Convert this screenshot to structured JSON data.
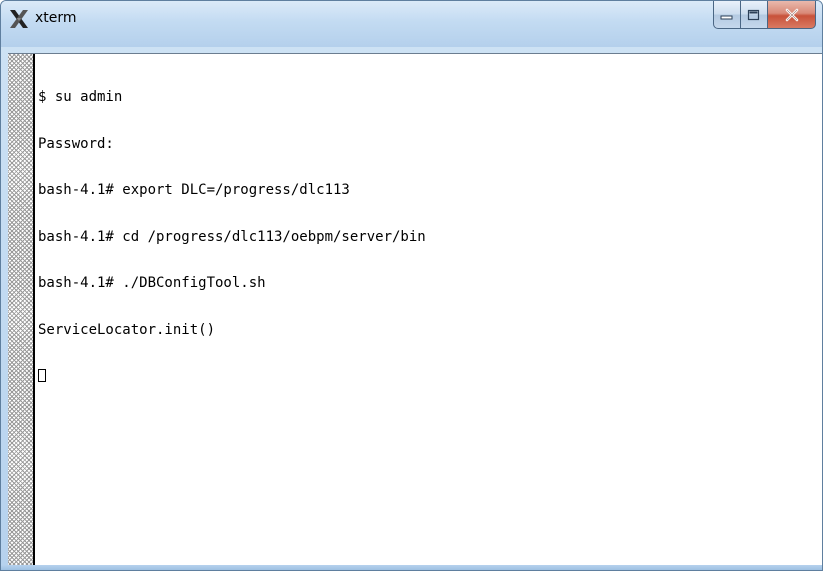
{
  "window": {
    "title": "xterm",
    "icon": "x-window-icon"
  },
  "controls": {
    "minimize_icon": "minimize-icon",
    "maximize_icon": "maximize-icon",
    "close_icon": "close-icon"
  },
  "terminal": {
    "lines": [
      "$ su admin",
      "Password:",
      "bash-4.1# export DLC=/progress/dlc113",
      "bash-4.1# cd /progress/dlc113/oebpm/server/bin",
      "bash-4.1# ./DBConfigTool.sh",
      "ServiceLocator.init()"
    ],
    "cursor": "block-cursor"
  },
  "colors": {
    "titlebar": "#c3dbf2",
    "close_button": "#c8523a",
    "terminal_bg": "#ffffff",
    "terminal_fg": "#000000"
  }
}
